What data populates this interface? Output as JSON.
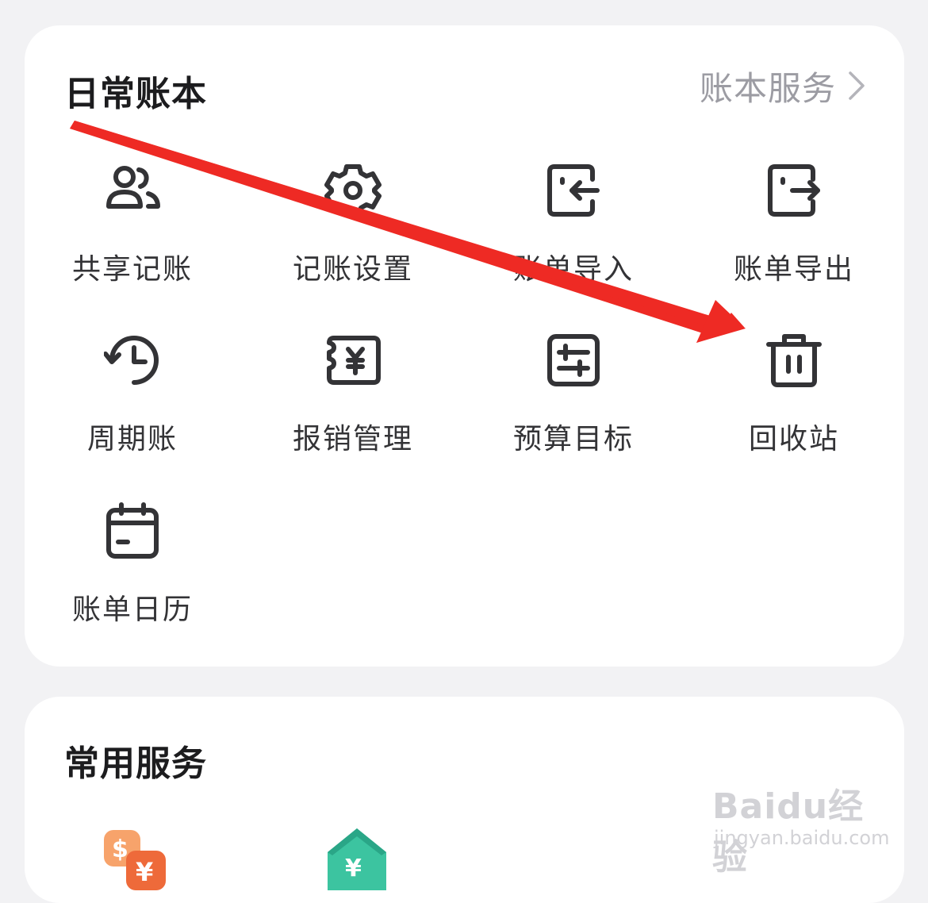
{
  "ledger": {
    "title": "日常账本",
    "service_link_label": "账本服务",
    "items": [
      {
        "label": "共享记账",
        "icon": "users-icon"
      },
      {
        "label": "记账设置",
        "icon": "gear-icon"
      },
      {
        "label": "账单导入",
        "icon": "import-icon"
      },
      {
        "label": "账单导出",
        "icon": "export-icon"
      },
      {
        "label": "周期账",
        "icon": "history-clock-icon"
      },
      {
        "label": "报销管理",
        "icon": "yuan-ticket-icon"
      },
      {
        "label": "预算目标",
        "icon": "sliders-icon"
      },
      {
        "label": "回收站",
        "icon": "trash-icon"
      },
      {
        "label": "账单日历",
        "icon": "calendar-icon"
      }
    ]
  },
  "services": {
    "title": "常用服务",
    "items": [
      {
        "icon": "currency-exchange-icon"
      },
      {
        "icon": "yuan-house-icon"
      }
    ]
  },
  "watermark": {
    "logo_text": "Baidu经验",
    "url": "jingyan.baidu.com"
  },
  "colors": {
    "background": "#f2f2f4",
    "card": "#ffffff",
    "icon_stroke": "#333336",
    "annotation_arrow": "#ee2a24",
    "service_orange": "#f27a3a",
    "service_green": "#3cc4a0"
  }
}
